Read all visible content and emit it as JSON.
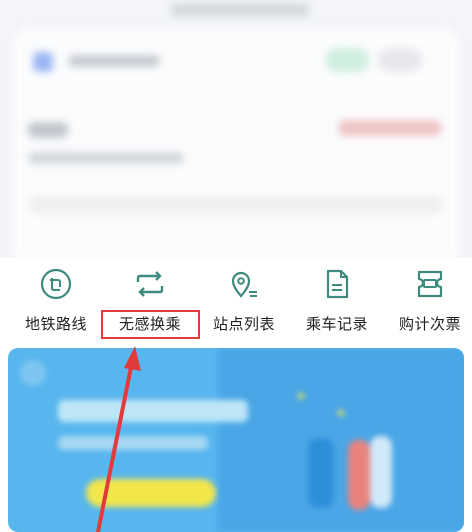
{
  "nav": {
    "items": [
      {
        "label": "地铁路线",
        "icon": "metro-route-icon"
      },
      {
        "label": "无感换乘",
        "icon": "transfer-icon"
      },
      {
        "label": "站点列表",
        "icon": "station-list-icon"
      },
      {
        "label": "乘车记录",
        "icon": "ride-record-icon"
      },
      {
        "label": "购计次票",
        "icon": "ticket-icon"
      }
    ],
    "highlighted_index": 1
  },
  "colors": {
    "icon_teal": "#3f8a7e",
    "annotation_red": "#e23b3b",
    "banner_blue": "#58b6ee"
  }
}
